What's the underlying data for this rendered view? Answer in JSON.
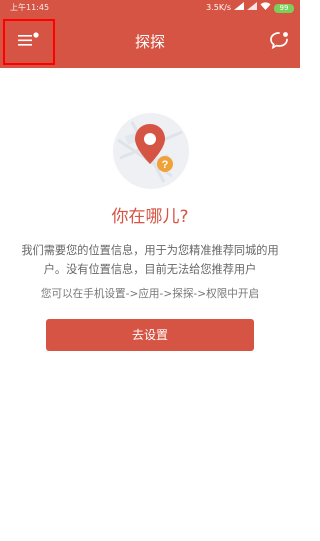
{
  "status_bar": {
    "time": "上午11:45",
    "network_speed": "3.5K/s",
    "battery": "99"
  },
  "app_bar": {
    "title": "探探",
    "menu_icon": "menu-icon",
    "message_icon": "message-icon"
  },
  "location_prompt": {
    "illustration_icon": "location-pin-icon",
    "heading": "你在哪儿?",
    "description": "我们需要您的位置信息，用于为您精准推荐同城的用户。没有位置信息，目前无法给您推荐用户",
    "hint": "您可以在手机设置->应用->探探->权限中开启",
    "button_label": "去设置"
  },
  "colors": {
    "brand_red": "#d65443",
    "highlight_box": "#ff0000",
    "battery_green": "#7ad05a"
  }
}
